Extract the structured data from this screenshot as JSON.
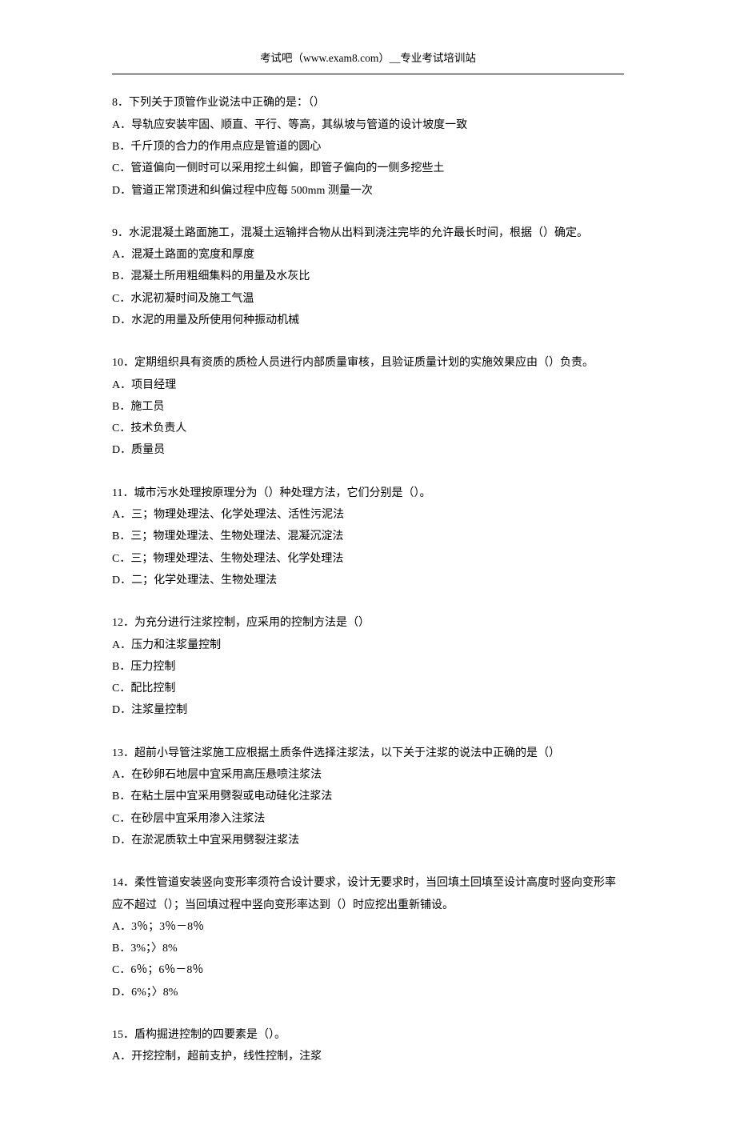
{
  "header": "考试吧（www.exam8.com）__专业考试培训站",
  "questions": [
    {
      "stem": "8．下列关于顶管作业说法中正确的是：（）",
      "options": [
        "A．导轨应安装牢固、顺直、平行、等高，其纵坡与管道的设计坡度一致",
        "B．千斤顶的合力的作用点应是管道的圆心",
        "C．管道偏向一侧时可以采用挖土纠偏，即管子偏向的一侧多挖些土",
        "D．管道正常顶进和纠偏过程中应每 500mm 测量一次"
      ]
    },
    {
      "stem": "9．水泥混凝土路面施工，混凝土运输拌合物从出料到浇注完毕的允许最长时间，根据（）确定。",
      "options": [
        "A．混凝土路面的宽度和厚度",
        "B．混凝土所用粗细集料的用量及水灰比",
        "C．水泥初凝时间及施工气温",
        "D．水泥的用量及所使用何种振动机械"
      ]
    },
    {
      "stem": "10．定期组织具有资质的质检人员进行内部质量审核，且验证质量计划的实施效果应由（）负责。",
      "options": [
        "A．项目经理",
        "B．施工员",
        "C．技术负责人",
        "D．质量员"
      ]
    },
    {
      "stem": "11．城市污水处理按原理分为（）种处理方法，它们分别是（）。",
      "options": [
        "A．三；物理处理法、化学处理法、活性污泥法",
        "B．三；物理处理法、生物处理法、混凝沉淀法",
        "C．三；物理处理法、生物处理法、化学处理法",
        "D．二；化学处理法、生物处理法"
      ]
    },
    {
      "stem": "12．为充分进行注浆控制，应采用的控制方法是（）",
      "options": [
        "A．压力和注浆量控制",
        "B．压力控制",
        "C．配比控制",
        "D．注浆量控制"
      ]
    },
    {
      "stem": "13．超前小导管注浆施工应根据土质条件选择注浆法，以下关于注浆的说法中正确的是（）",
      "options": [
        "A．在砂卵石地层中宜采用高压悬喷注浆法",
        "B．在粘土层中宜采用劈裂或电动硅化注浆法",
        "C．在砂层中宜采用渗入注浆法",
        "D．在淤泥质软土中宜采用劈裂注浆法"
      ]
    },
    {
      "stem": "14．柔性管道安装竖向变形率须符合设计要求，设计无要求时，当回填土回填至设计高度时竖向变形率应不超过（）；当回填过程中竖向变形率达到（）时应挖出重新铺设。",
      "options": [
        "A．3％；3％－8％",
        "B．3%；〉8%",
        "C．6％；6％－8％",
        "D．6%；〉8%"
      ]
    },
    {
      "stem": "15．盾构掘进控制的四要素是（）。",
      "options": [
        "A．开挖控制，超前支护，线性控制，注浆"
      ]
    }
  ]
}
